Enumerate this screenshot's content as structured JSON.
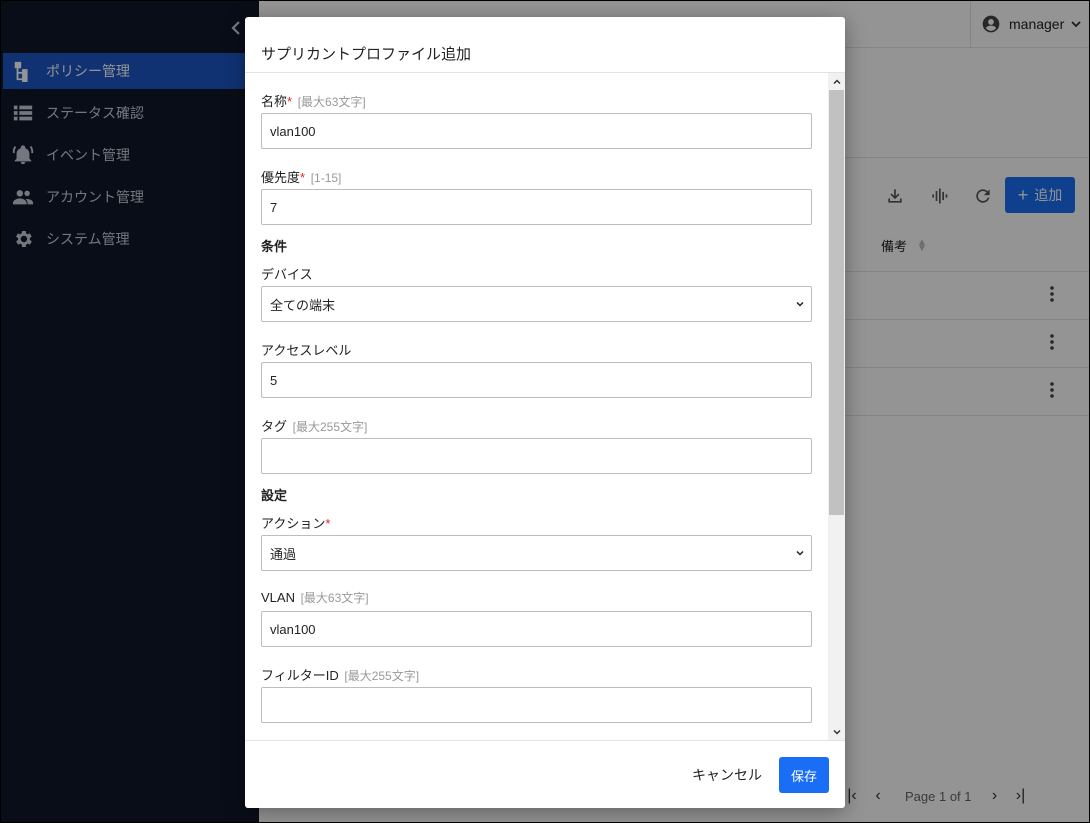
{
  "sidebar": {
    "items": [
      {
        "label": "ポリシー管理",
        "icon": "policy-tree-icon",
        "active": true
      },
      {
        "label": "ステータス確認",
        "icon": "list-icon",
        "active": false
      },
      {
        "label": "イベント管理",
        "icon": "bell-icon",
        "active": false
      },
      {
        "label": "アカウント管理",
        "icon": "people-icon",
        "active": false
      },
      {
        "label": "システム管理",
        "icon": "gear-icon",
        "active": false
      }
    ]
  },
  "topbar": {
    "user": "manager"
  },
  "content": {
    "add_label": "追加",
    "column_remarks": "備考",
    "pagination": "Page 1 of 1"
  },
  "modal": {
    "title": "サプリカントプロファイル追加",
    "conditions_heading": "条件",
    "settings_heading": "設定",
    "fields": {
      "name": {
        "label": "名称",
        "required": "*",
        "hint": "[最大63文字]",
        "value": "vlan100"
      },
      "priority": {
        "label": "優先度",
        "required": "*",
        "hint": "[1-15]",
        "value": "7"
      },
      "device": {
        "label": "デバイス",
        "value": "全ての端末"
      },
      "access_level": {
        "label": "アクセスレベル",
        "value": "5"
      },
      "tag": {
        "label": "タグ",
        "hint": "[最大255文字]",
        "value": ""
      },
      "action": {
        "label": "アクション",
        "required": "*",
        "value": "通過"
      },
      "vlan": {
        "label": "VLAN",
        "hint": "[最大63文字]",
        "value": "vlan100"
      },
      "filter_id": {
        "label": "フィルターID",
        "hint": "[最大255文字]",
        "value": ""
      }
    },
    "cancel_label": "キャンセル",
    "save_label": "保存"
  },
  "colors": {
    "sidebar_bg": "#101828",
    "active_nav": "#1d56c6",
    "primary": "#1a6ef5",
    "required": "#e02424"
  }
}
